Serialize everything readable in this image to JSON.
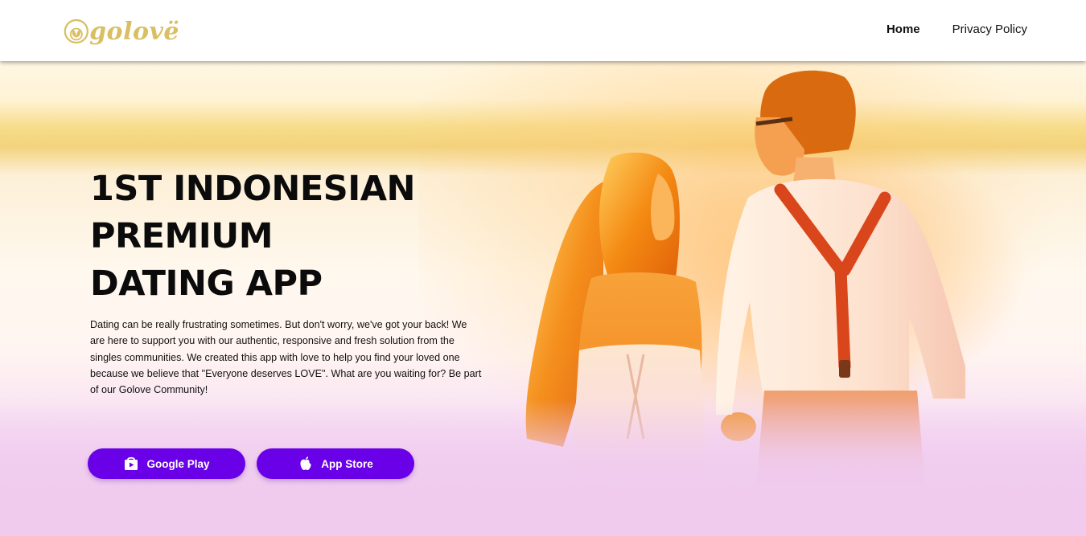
{
  "header": {
    "logo_text": "golovë",
    "nav": [
      {
        "label": "Home",
        "active": true
      },
      {
        "label": "Privacy Policy",
        "active": false
      }
    ]
  },
  "hero": {
    "headline": [
      "1ST INDONESIAN",
      "PREMIUM",
      "DATING APP"
    ],
    "description": "Dating can be really frustrating sometimes. But don't worry, we've got your back! We are here to support you with our authentic, responsive and fresh solution from the singles communities. We created this app with love to help you find your loved one because we believe that \"Everyone deserves LOVE\". What are you waiting for? Be part of our Golove Community!",
    "buttons": {
      "google_play": "Google Play",
      "app_store": "App Store"
    }
  },
  "icons": {
    "logo": "leaf-circle-icon",
    "google_play": "play-store-icon",
    "app_store": "apple-icon"
  },
  "colors": {
    "brand_gold": "#d9bf62",
    "button_purple": "#6a00e8",
    "footer_pink": "#f0cbee"
  }
}
